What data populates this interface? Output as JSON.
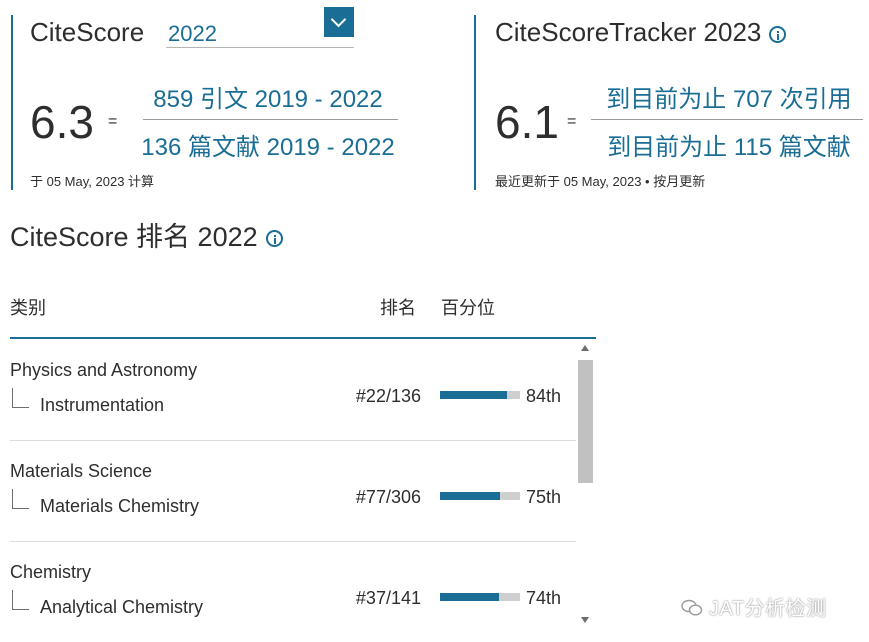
{
  "citescore": {
    "title": "CiteScore",
    "year": "2022",
    "score": "6.3",
    "equals": "=",
    "numerator": "859 引文 2019 - 2022",
    "denominator": "136 篇文献 2019 - 2022",
    "calc_note": "于 05 May, 2023 计算"
  },
  "tracker": {
    "title": "CiteScoreTracker 2023",
    "score": "6.1",
    "equals": "=",
    "numerator": "到目前为止 707 次引用",
    "denominator": "到目前为止 115 篇文献",
    "update_note": "最近更新于 05 May, 2023 • 按月更新"
  },
  "ranking": {
    "title": "CiteScore 排名 2022",
    "columns": {
      "category": "类别",
      "rank": "排名",
      "percentile": "百分位"
    },
    "rows": [
      {
        "category": "Physics and Astronomy",
        "subcategory": "Instrumentation",
        "rank": "#22/136",
        "percentile_label": "84th",
        "percentile": 84
      },
      {
        "category": "Materials Science",
        "subcategory": "Materials Chemistry",
        "rank": "#77/306",
        "percentile_label": "75th",
        "percentile": 75
      },
      {
        "category": "Chemistry",
        "subcategory": "Analytical Chemistry",
        "rank": "#37/141",
        "percentile_label": "74th",
        "percentile": 74
      }
    ]
  },
  "watermark": {
    "text": "JAT分析检测"
  },
  "colors": {
    "accent": "#1a6d95",
    "bar_track": "#cfcfcf"
  }
}
